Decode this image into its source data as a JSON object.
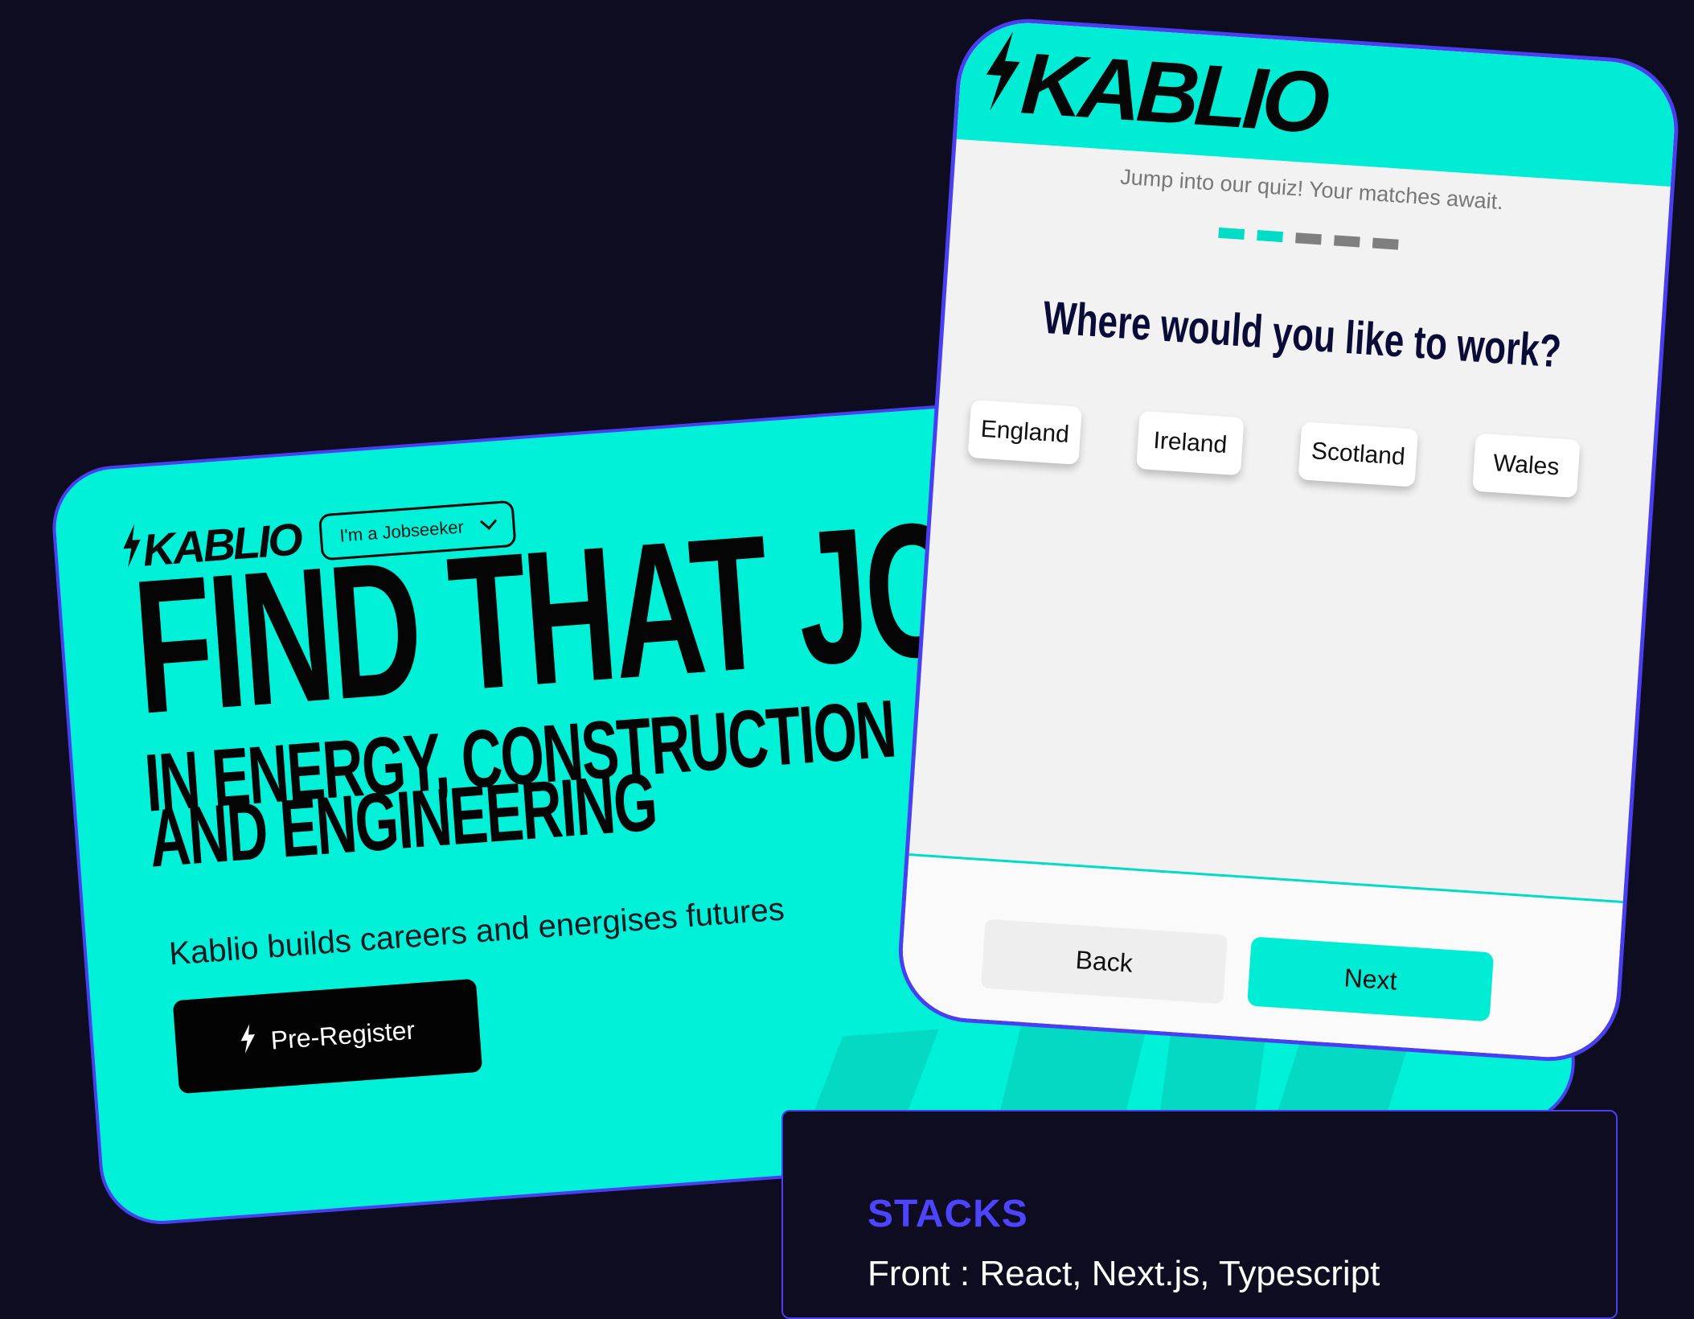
{
  "landing": {
    "logo": "KABLIO",
    "role_select": {
      "value": "I'm a Jobseeker"
    },
    "headline_line1": "FIND THAT JOB",
    "headline_line2": "IN ENERGY, CONSTRUCTION",
    "headline_line3": "AND ENGINEERING",
    "tagline": "Kablio builds careers and energises futures",
    "cta_label": "Pre-Register"
  },
  "quiz": {
    "logo": "KABLIO",
    "subtitle": "Jump into our quiz! Your matches await.",
    "progress": {
      "current_step": 2,
      "total_steps": 5
    },
    "question": "Where would you like to work?",
    "options": [
      "England",
      "Ireland",
      "Scotland",
      "Wales"
    ],
    "back_label": "Back",
    "next_label": "Next"
  },
  "stacks": {
    "title": "STACKS",
    "front": "Front : React, Next.js, Typescript"
  },
  "colors": {
    "background": "#0e0c20",
    "accent_teal": "#00f0d8",
    "border_purple": "#4a3ff0",
    "stacks_title": "#4e44ff"
  }
}
